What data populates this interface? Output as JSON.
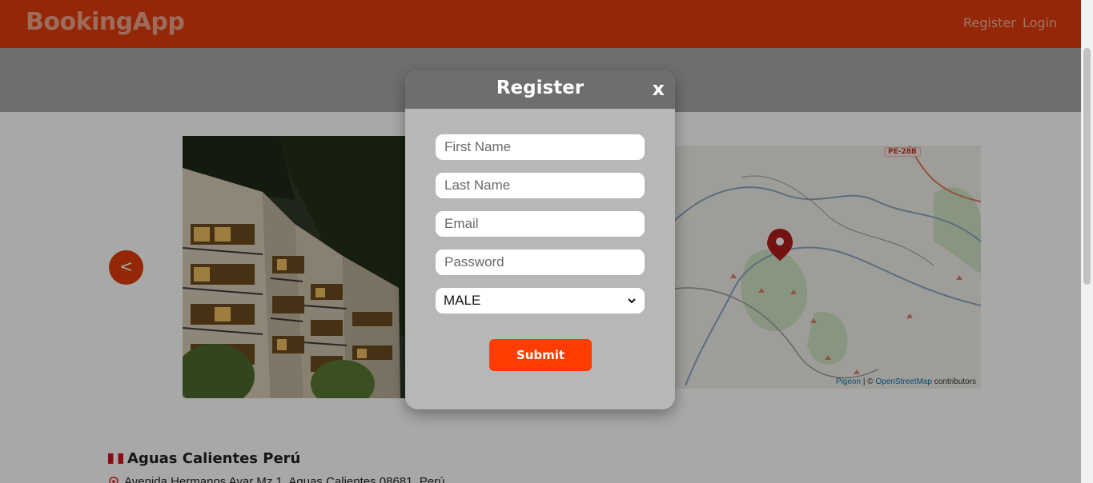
{
  "nav": {
    "brand": "BookingApp",
    "register_label": "Register",
    "login_label": "Login"
  },
  "carousel": {
    "prev_label": "<"
  },
  "map": {
    "road_badge": "PE-28B",
    "attribution_pigeon": "Pigeon",
    "attribution_sep": " | © ",
    "attribution_osm": "OpenStreetMap",
    "attribution_contrib": " contributors"
  },
  "place": {
    "name": "Aguas Calientes Perú",
    "address": "Avenida Hermanos Ayar Mz 1, Aguas Calientes 08681, Perú"
  },
  "modal": {
    "title": "Register",
    "close_label": "x",
    "first_name_placeholder": "First Name",
    "last_name_placeholder": "Last Name",
    "email_placeholder": "Email",
    "password_placeholder": "Password",
    "gender_selected": "MALE",
    "submit_label": "Submit"
  },
  "colors": {
    "accent": "#e03c0c",
    "submit": "#ff3d00",
    "modal_bg": "#b7b7b7",
    "modal_header": "#6e6e6e"
  }
}
